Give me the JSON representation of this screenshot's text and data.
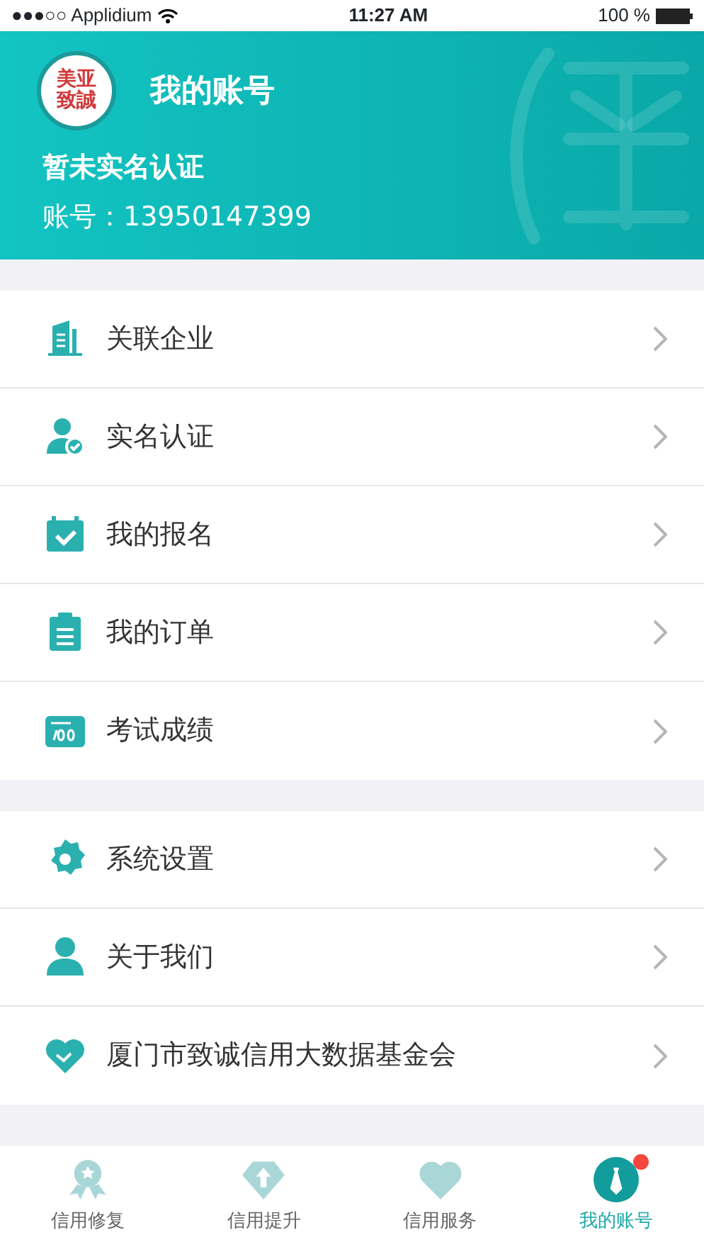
{
  "status_bar": {
    "carrier": "●●●○○ Applidium",
    "time": "11:27 AM",
    "battery": "100 %"
  },
  "header": {
    "logo_lines": [
      "美亚",
      "致誠"
    ],
    "title": "我的账号",
    "verification": "暂未实名认证",
    "account": "账号：13950147399"
  },
  "menu_groups": [
    {
      "items": [
        {
          "label": "关联企业"
        },
        {
          "label": "实名认证"
        },
        {
          "label": "我的报名"
        },
        {
          "label": "我的订单"
        },
        {
          "label": "考试成绩"
        }
      ]
    },
    {
      "items": [
        {
          "label": "系统设置"
        },
        {
          "label": "关于我们"
        },
        {
          "label": "厦门市致诚信用大数据基金会"
        }
      ]
    }
  ],
  "tab_bar": [
    {
      "label": "信用修复",
      "selected": false,
      "dot": false
    },
    {
      "label": "信用提升",
      "selected": false,
      "dot": false
    },
    {
      "label": "信用服务",
      "selected": false,
      "dot": false
    },
    {
      "label": "我的账号",
      "selected": true,
      "dot": true
    }
  ]
}
